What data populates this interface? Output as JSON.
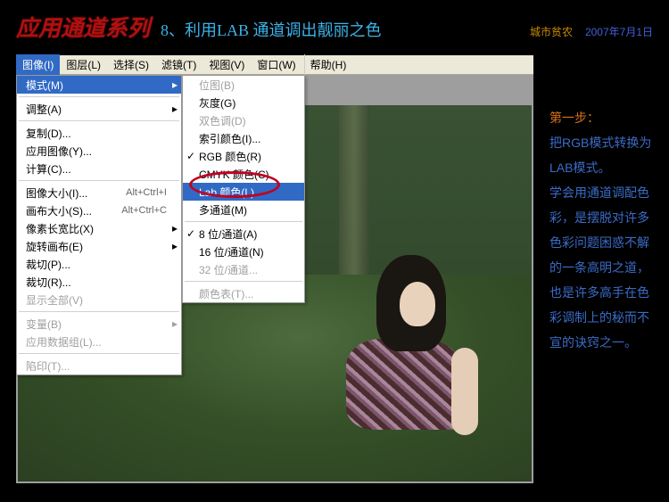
{
  "header": {
    "main": "应用通道系列",
    "sub": "8、利用LAB 通道调出靓丽之色",
    "author": "城市贫农",
    "date": "2007年7月1日"
  },
  "menubar": {
    "items": [
      "图像(I)",
      "图层(L)",
      "选择(S)",
      "滤镜(T)",
      "视图(V)",
      "窗口(W)",
      "帮助(H)"
    ]
  },
  "menu1": [
    {
      "t": "模式(M)",
      "sel": true,
      "arr": true
    },
    {
      "sep": 1
    },
    {
      "t": "调整(A)",
      "arr": true
    },
    {
      "sep": 1
    },
    {
      "t": "复制(D)..."
    },
    {
      "t": "应用图像(Y)..."
    },
    {
      "t": "计算(C)..."
    },
    {
      "sep": 1
    },
    {
      "t": "图像大小(I)...",
      "sc": "Alt+Ctrl+I"
    },
    {
      "t": "画布大小(S)...",
      "sc": "Alt+Ctrl+C"
    },
    {
      "t": "像素长宽比(X)",
      "arr": true
    },
    {
      "t": "旋转画布(E)",
      "arr": true
    },
    {
      "t": "裁切(P)..."
    },
    {
      "t": "裁切(R)..."
    },
    {
      "t": "显示全部(V)",
      "dis": true
    },
    {
      "sep": 1
    },
    {
      "t": "变量(B)",
      "dis": true,
      "arr": true
    },
    {
      "t": "应用数据组(L)...",
      "dis": true
    },
    {
      "sep": 1
    },
    {
      "t": "陷印(T)...",
      "dis": true
    }
  ],
  "menu2": [
    {
      "t": "位图(B)",
      "dis": true
    },
    {
      "t": "灰度(G)"
    },
    {
      "t": "双色调(D)",
      "dis": true
    },
    {
      "t": "索引颜色(I)..."
    },
    {
      "t": "RGB 颜色(R)",
      "chk": true
    },
    {
      "t": "CMYK 颜色(C)"
    },
    {
      "t": "Lab 颜色(L)",
      "sel": true
    },
    {
      "t": "多通道(M)"
    },
    {
      "sep": 1
    },
    {
      "t": "8 位/通道(A)",
      "chk": true
    },
    {
      "t": "16 位/通道(N)"
    },
    {
      "t": "32 位/通道...",
      "dis": true
    },
    {
      "sep": 1
    },
    {
      "t": "颜色表(T)...",
      "dis": true
    }
  ],
  "sidebar": {
    "step": "第一步：",
    "body": "把RGB模式转换为LAB模式。\n学会用通道调配色彩，是摆脱对许多色彩问题困惑不解的一条高明之道，也是许多高手在色彩调制上的秘而不宣的诀窍之一。"
  }
}
